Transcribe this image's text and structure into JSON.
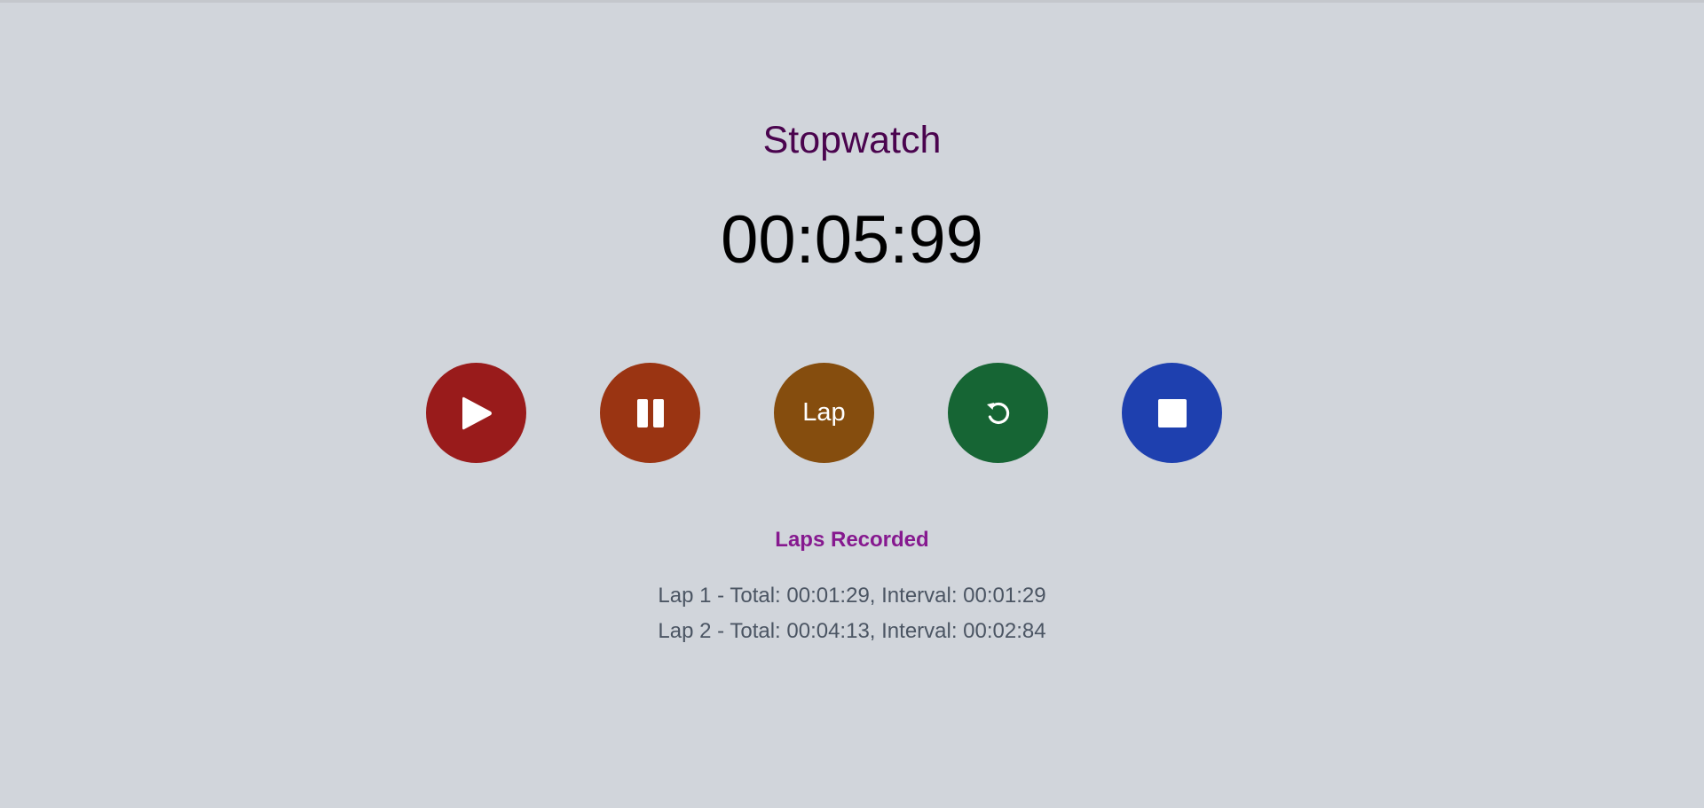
{
  "app": {
    "title": "Stopwatch",
    "time": "00:05:99"
  },
  "controls": [
    {
      "name": "start-button",
      "icon": "play-icon",
      "color": "#991b1b",
      "label": ""
    },
    {
      "name": "pause-button",
      "icon": "pause-icon",
      "color": "#9a3412",
      "label": ""
    },
    {
      "name": "lap-button",
      "icon": "",
      "color": "#854d0e",
      "label": "Lap"
    },
    {
      "name": "reset-button",
      "icon": "refresh-icon",
      "color": "#166534",
      "label": ""
    },
    {
      "name": "stop-button",
      "icon": "stop-icon",
      "color": "#1e40af",
      "label": ""
    }
  ],
  "laps": {
    "heading": "Laps Recorded",
    "items": [
      "Lap 1 - Total: 00:01:29, Interval: 00:01:29",
      "Lap 2 - Total: 00:04:13, Interval: 00:02:84"
    ]
  }
}
